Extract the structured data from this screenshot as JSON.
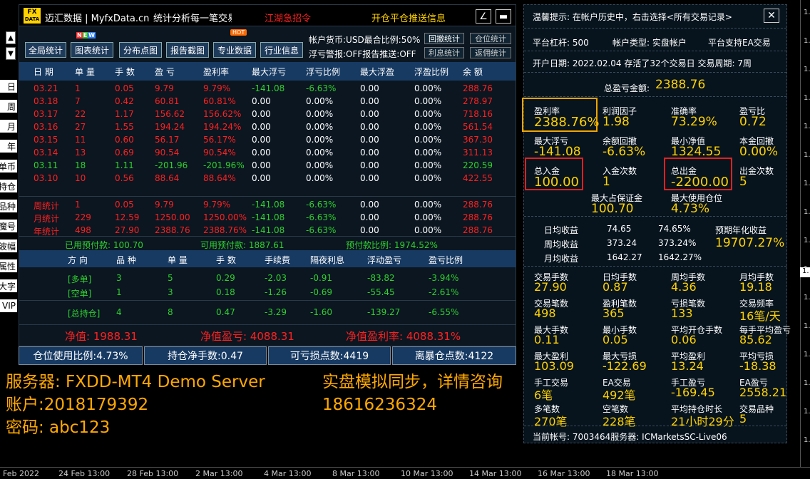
{
  "title_bar": {
    "app_name": "迈汇数据 | MyfxData.cn",
    "slogan": "统计分析每一笔交易",
    "recruit": "江湖急招令",
    "push": "开仓平仓推送信息",
    "logo_top": "FX",
    "logo_bottom": "DATA"
  },
  "toolbar": {
    "buttons": [
      "全局统计",
      "图表统计",
      "分布点图",
      "报告截图",
      "专业数据",
      "行业信息"
    ],
    "badge_new": "NEW",
    "badge_hot": "HOT",
    "info_line1": "帐户货币:USD最合比例:50%",
    "info_line2": "浮亏警报:OFF报告推送:OFF",
    "btn_callback": "回撤统计",
    "btn_position": "仓位统计",
    "btn_profit": "利息统计",
    "btn_rebate": "返佣统计"
  },
  "side_buttons": [
    "日",
    "周",
    "月",
    "年",
    "单币",
    "持仓",
    "品种",
    "魔号",
    "波幅",
    "属性",
    "大字",
    "VIP"
  ],
  "table": {
    "headers": [
      "日 期",
      "单 量",
      "手 数",
      "盈 亏",
      "盈利率",
      "最大浮亏",
      "浮亏比例",
      "最大浮盈",
      "浮盈比例",
      "余 额"
    ],
    "rows": [
      {
        "cells": [
          "03.21",
          "1",
          "0.05",
          "9.79",
          "9.79%",
          "-141.08",
          "-6.63%",
          "0.00",
          "0.00%",
          "288.76"
        ],
        "color": "red"
      },
      {
        "cells": [
          "03.18",
          "7",
          "0.42",
          "60.81",
          "60.81%",
          "0.00",
          "0.00%",
          "0.00",
          "0.00%",
          "278.97"
        ],
        "color": "red"
      },
      {
        "cells": [
          "03.17",
          "22",
          "1.17",
          "156.62",
          "156.62%",
          "0.00",
          "0.00%",
          "0.00",
          "0.00%",
          "718.16"
        ],
        "color": "red"
      },
      {
        "cells": [
          "03.16",
          "27",
          "1.55",
          "194.24",
          "194.24%",
          "0.00",
          "0.00%",
          "0.00",
          "0.00%",
          "561.54"
        ],
        "color": "red"
      },
      {
        "cells": [
          "03.15",
          "11",
          "0.60",
          "56.17",
          "56.17%",
          "0.00",
          "0.00%",
          "0.00",
          "0.00%",
          "367.30"
        ],
        "color": "red"
      },
      {
        "cells": [
          "03.14",
          "13",
          "0.69",
          "90.54",
          "90.54%",
          "0.00",
          "0.00%",
          "0.00",
          "0.00%",
          "311.13"
        ],
        "color": "red"
      },
      {
        "cells": [
          "03.11",
          "18",
          "1.11",
          "-201.96",
          "-201.96%",
          "0.00",
          "0.00%",
          "0.00",
          "0.00%",
          "220.59"
        ],
        "color": "green"
      },
      {
        "cells": [
          "03.10",
          "10",
          "0.56",
          "88.64",
          "88.64%",
          "0.00",
          "0.00%",
          "0.00",
          "0.00%",
          "422.55"
        ],
        "color": "red"
      }
    ],
    "stats": [
      {
        "cells": [
          "周统计",
          "1",
          "0.05",
          "9.79",
          "9.79%",
          "-141.08",
          "-6.63%",
          "0.00",
          "0.00%",
          "288.76"
        ]
      },
      {
        "cells": [
          "月统计",
          "229",
          "12.59",
          "1250.00",
          "1250.00%",
          "-141.08",
          "-6.63%",
          "0.00",
          "0.00%",
          "288.76"
        ]
      },
      {
        "cells": [
          "年统计",
          "498",
          "27.90",
          "2388.76",
          "2388.76%",
          "-141.08",
          "-6.63%",
          "0.00",
          "0.00%",
          "288.76"
        ]
      }
    ]
  },
  "avail": {
    "used": "已用预付款: 100.70",
    "free": "可用预付款: 1887.61",
    "ratio": "预付款比例: 1974.52%"
  },
  "positions": {
    "headers": [
      "方 向",
      "品 种",
      "单 量",
      "手 数",
      "手续费",
      "隔夜利息",
      "浮动盈亏",
      "盈亏比例"
    ],
    "rows": [
      {
        "cells": [
          "[多单]",
          "3",
          "5",
          "0.29",
          "-2.03",
          "-0.91",
          "-83.82",
          "-3.94%"
        ]
      },
      {
        "cells": [
          "[空单]",
          "1",
          "3",
          "0.18",
          "-1.26",
          "-0.69",
          "-55.45",
          "-2.61%"
        ]
      },
      {
        "cells": [
          "[总持仓]",
          "4",
          "8",
          "0.47",
          "-3.29",
          "-1.60",
          "-139.27",
          "-6.55%"
        ]
      }
    ]
  },
  "summary": {
    "net": "净值: 1988.31",
    "net_pl": "净值盈亏: 4088.31",
    "net_rate": "净值盈利率: 4088.31%"
  },
  "bottom_bar": [
    "仓位使用比例:4.73%",
    "持仓净手数:0.47",
    "可亏损点数:4419",
    "离暴仓点数:4122"
  ],
  "server_info": [
    "服务器: FXDD-MT4 Demo Server",
    "账户:2018179392",
    "密码: abc123"
  ],
  "promo_info": [
    "实盘模拟同步，详情咨询",
    "18616236324"
  ],
  "right": {
    "tip": "温馨提示: 在帐户历史中，右击选择<所有交易记录>",
    "leverage": "平台杠杆: 500",
    "account_type": "帐户类型: 实盘帐户",
    "ea_support": "平台支持EA交易",
    "open_date": "开户日期: 2022.02.04 存活了32个交易日 交易周期: 7周",
    "total_pl_label": "总盈亏金额:",
    "total_pl_value": "2388.76",
    "metrics": [
      {
        "label": "盈利率",
        "value": "2388.76%"
      },
      {
        "label": "利润因子",
        "value": "1.98"
      },
      {
        "label": "准确率",
        "value": "73.29%"
      },
      {
        "label": "盈亏比",
        "value": "0.72"
      },
      {
        "label": "最大浮亏",
        "value": "-141.08"
      },
      {
        "label": "余额回撤",
        "value": "-6.63%"
      },
      {
        "label": "最小净值",
        "value": "1324.55"
      },
      {
        "label": "本金回撤",
        "value": "0.00%"
      },
      {
        "label": "总入金",
        "value": "100.00"
      },
      {
        "label": "入金次数",
        "value": "1"
      },
      {
        "label": "总出金",
        "value": "-2200.00"
      },
      {
        "label": "出金次数",
        "value": "5"
      },
      {
        "label": "最大占保证金",
        "value": "100.70"
      },
      {
        "label": "最大使用仓位",
        "value": "4.73%"
      }
    ],
    "returns": [
      {
        "label": "日均收益",
        "v1": "74.65",
        "v2": "74.65%"
      },
      {
        "label": "周均收益",
        "v1": "373.24",
        "v2": "373.24%"
      },
      {
        "label": "月均收益",
        "v1": "1642.27",
        "v2": "1642.27%"
      }
    ],
    "annual_label": "预期年化收益",
    "annual_value": "19707.27%",
    "grid": [
      {
        "label": "交易手数",
        "value": "27.90"
      },
      {
        "label": "日均手数",
        "value": "0.87"
      },
      {
        "label": "周均手数",
        "value": "4.36"
      },
      {
        "label": "月均手数",
        "value": "19.18"
      },
      {
        "label": "交易笔数",
        "value": "498"
      },
      {
        "label": "盈利笔数",
        "value": "365"
      },
      {
        "label": "亏损笔数",
        "value": "133"
      },
      {
        "label": "交易频率",
        "value": "16笔/天"
      },
      {
        "label": "最大手数",
        "value": "0.11"
      },
      {
        "label": "最小手数",
        "value": "0.05"
      },
      {
        "label": "平均开仓手数",
        "value": "0.06"
      },
      {
        "label": "每手平均盈亏",
        "value": "85.62"
      },
      {
        "label": "最大盈利",
        "value": "103.09"
      },
      {
        "label": "最大亏损",
        "value": "-122.69"
      },
      {
        "label": "平均盈利",
        "value": "13.24"
      },
      {
        "label": "平均亏损",
        "value": "-18.38"
      },
      {
        "label": "手工交易",
        "value": "6笔"
      },
      {
        "label": "EA交易",
        "value": "492笔"
      },
      {
        "label": "手工盈亏",
        "value": "-169.45"
      },
      {
        "label": "EA盈亏",
        "value": "2558.21"
      },
      {
        "label": "多笔数",
        "value": "270笔"
      },
      {
        "label": "空笔数",
        "value": "228笔"
      },
      {
        "label": "平均持仓时长",
        "value": "21小时29分"
      },
      {
        "label": "交易品种",
        "value": "5"
      }
    ],
    "footer": "当前帐号: 7003464服务器: ICMarketsSC-Live06",
    "colors": {
      "orange_box": "#f0a500",
      "red_box": "#e02020"
    }
  },
  "time_axis": [
    "Feb 2022",
    "24 Feb 13:00",
    "28 Feb 13:00",
    "2 Mar 13:00",
    "4 Mar 13:00",
    "8 Mar 13:00",
    "10 Mar 13:00",
    "14 Mar 13:00",
    "16 Mar 13:00",
    "18 Mar 13:00"
  ],
  "price_axis": [
    "1.",
    "1.",
    "1.",
    "1.",
    "1.",
    "1.",
    "1.",
    "1.",
    "1.",
    "1.",
    "1.",
    "1.",
    "1.",
    "1.",
    "1.",
    "1."
  ],
  "price_marker": "1."
}
